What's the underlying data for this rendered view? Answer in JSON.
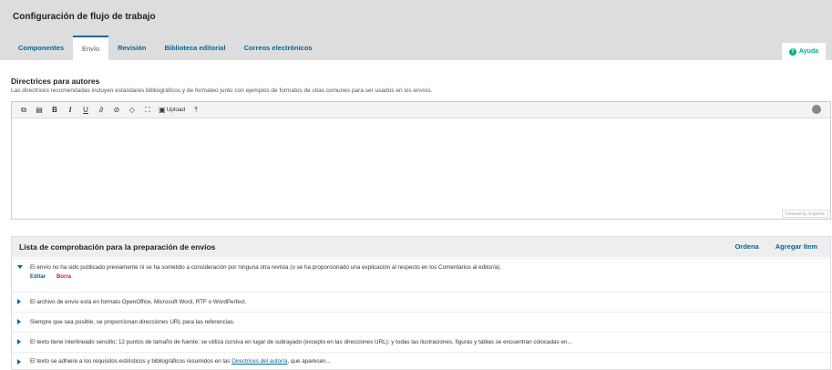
{
  "header": {
    "title": "Configuración de flujo de trabajo",
    "tabs": [
      {
        "label": "Componentes"
      },
      {
        "label": "Envío"
      },
      {
        "label": "Revisión"
      },
      {
        "label": "Biblioteca editorial"
      },
      {
        "label": "Correos electrónicos"
      }
    ],
    "active_tab": "Envío",
    "help_label": "Ayuda"
  },
  "guidelines": {
    "title": "Directrices para autores",
    "description": "Las directrices recomendadas incluyen estándares bibliográficos y de formateo junto con ejemplos de formatos de citas comunes para ser usados en los envíos.",
    "toolbar": {
      "icons": [
        "copy-icon",
        "paste-icon",
        "bold-icon",
        "italic-icon",
        "underline-icon",
        "link-icon",
        "unlink-icon",
        "code-icon",
        "fullscreen-icon",
        "image-icon",
        "upload-icon"
      ],
      "bold": "B",
      "italic": "I",
      "underline": "U",
      "upload_label": "Upload"
    },
    "powered_by": "Powered by TinyMCE"
  },
  "checklist": {
    "title": "Lista de comprobación para la preparación de envíos",
    "order_label": "Ordena",
    "add_label": "Agregar ítem",
    "items": [
      {
        "text": "El envío no ha sido publicado previamente ni se ha sometido a consideración por ninguna otra revista (o se ha proporcionado una explicación al respecto en los Comentarios al editor/a)."
      },
      {
        "text": "El archivo de envío está en formato OpenOffice, Microsoft Word, RTF o WordPerfect."
      },
      {
        "text": "Siempre que sea posible, se proporcionan direcciones URL para las referencias."
      },
      {
        "text": "El texto tiene interlineado sencillo; 12 puntos de tamaño de fuente; se utiliza cursiva en lugar de subrayado (excepto en las direcciones URL); y todas las ilustraciones, figuras y tablas se encuentran colocadas en..."
      },
      {
        "text_before": "El texto se adhiere a los requisitos estilísticos y bibliográficos resumidos en las ",
        "link": "Directrices del autor/a",
        "text_after": ", que aparecen..."
      }
    ],
    "edit_label": "Editar",
    "delete_label": "Borra"
  },
  "colors": {
    "accent": "#006798",
    "help": "#00b28d",
    "delete": "#d00a6c"
  }
}
